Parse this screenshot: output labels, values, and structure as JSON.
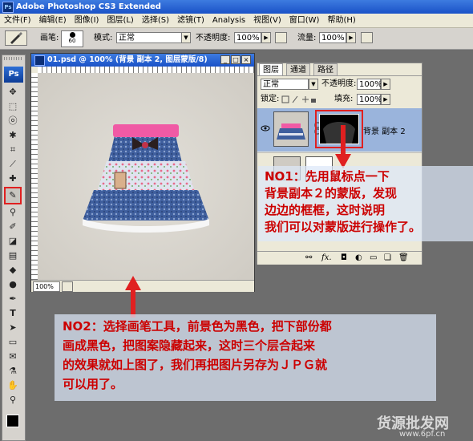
{
  "app": {
    "title": "Adobe Photoshop CS3 Extended",
    "logo": "Ps"
  },
  "menu": [
    "文件(F)",
    "编辑(E)",
    "图像(I)",
    "图层(L)",
    "选择(S)",
    "滤镜(T)",
    "Analysis",
    "视图(V)",
    "窗口(W)",
    "帮助(H)"
  ],
  "options_bar": {
    "brush_label": "画笔:",
    "brush_size": "60",
    "mode_label": "模式:",
    "mode_value": "正常",
    "opacity_label": "不透明度:",
    "opacity_value": "100%",
    "flow_label": "流量:",
    "flow_value": "100%"
  },
  "document": {
    "title": "01.psd @ 100% (背景 副本 2, 图层蒙版/8)",
    "zoom": "100%"
  },
  "layers_panel": {
    "tabs": [
      "图层",
      "通道",
      "路径"
    ],
    "blend_mode": "正常",
    "opacity_label": "不透明度:",
    "opacity_value": "100%",
    "lock_label": "锁定:",
    "fill_label": "填充:",
    "fill_value": "100%",
    "active_layer_name": "背景 副本 2",
    "footer_icons": [
      "link-icon",
      "fx-icon",
      "mask-icon",
      "adjustment-icon",
      "folder-icon",
      "new-layer-icon",
      "trash-icon"
    ]
  },
  "annotations": {
    "note1": [
      "NO1：先用鼠标点一下",
      "背景副本２的蒙版，发现",
      "边边的框框，这时说明",
      "我们可以对蒙版进行操作了。"
    ],
    "note2": [
      "NO2：选择画笔工具，前景色为黑色，把下部份都",
      "画成黑色，把图案隐藏起来，这时三个层合起来",
      "的效果就如上图了，我们再把图片另存为ＪＰＧ就",
      "可以用了。"
    ]
  },
  "watermark": {
    "text": "货源批发网",
    "url": "www.6pf.cn"
  },
  "colors": {
    "highlight": "#e02020",
    "note_text": "#cc0000"
  }
}
